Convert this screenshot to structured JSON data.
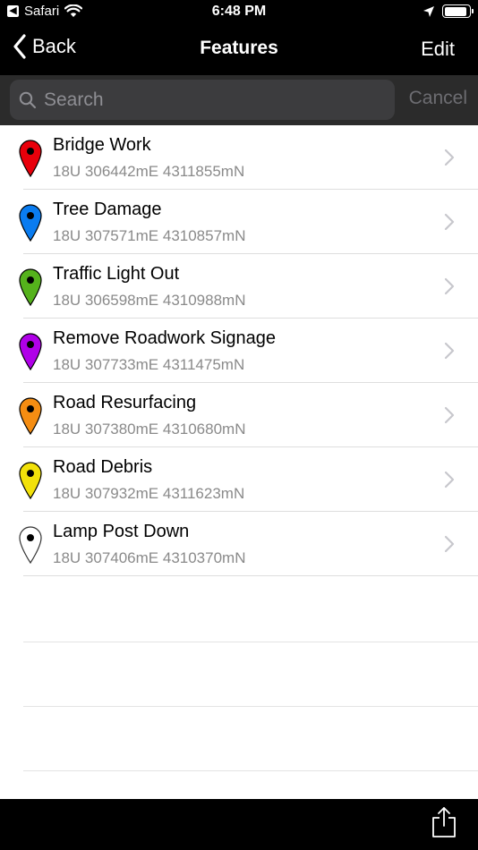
{
  "status_bar": {
    "back_app": "Safari",
    "time": "6:48 PM",
    "battery_level": 0.92,
    "icons": [
      "back-to-app-icon",
      "wifi-icon",
      "location-arrow-icon",
      "battery-icon"
    ]
  },
  "nav": {
    "back_label": "Back",
    "title": "Features",
    "edit_label": "Edit"
  },
  "search": {
    "placeholder": "Search",
    "value": "",
    "cancel_label": "Cancel"
  },
  "features": [
    {
      "name": "Bridge Work",
      "coords": "18U 306442mE 4311855mN",
      "pin_color": "#e8000b"
    },
    {
      "name": "Tree Damage",
      "coords": "18U 307571mE 4310857mN",
      "pin_color": "#0a7cf0"
    },
    {
      "name": "Traffic Light Out",
      "coords": "18U 306598mE 4310988mN",
      "pin_color": "#55b21c"
    },
    {
      "name": "Remove Roadwork Signage",
      "coords": "18U 307733mE 4311475mN",
      "pin_color": "#b000e8"
    },
    {
      "name": "Road Resurfacing",
      "coords": "18U 307380mE 4310680mN",
      "pin_color": "#f58d12"
    },
    {
      "name": "Road Debris",
      "coords": "18U 307932mE 4311623mN",
      "pin_color": "#f2e10a"
    },
    {
      "name": "Lamp Post Down",
      "coords": "18U 307406mE 4310370mN",
      "pin_color": "#ffffff"
    }
  ],
  "toolbar": {
    "icons": [
      "share-icon"
    ]
  },
  "colors": {
    "bar_background": "#000000",
    "search_background": "#2b2b2b",
    "chevron": "#c7c7cc",
    "subtitle": "#8a8a8a"
  }
}
